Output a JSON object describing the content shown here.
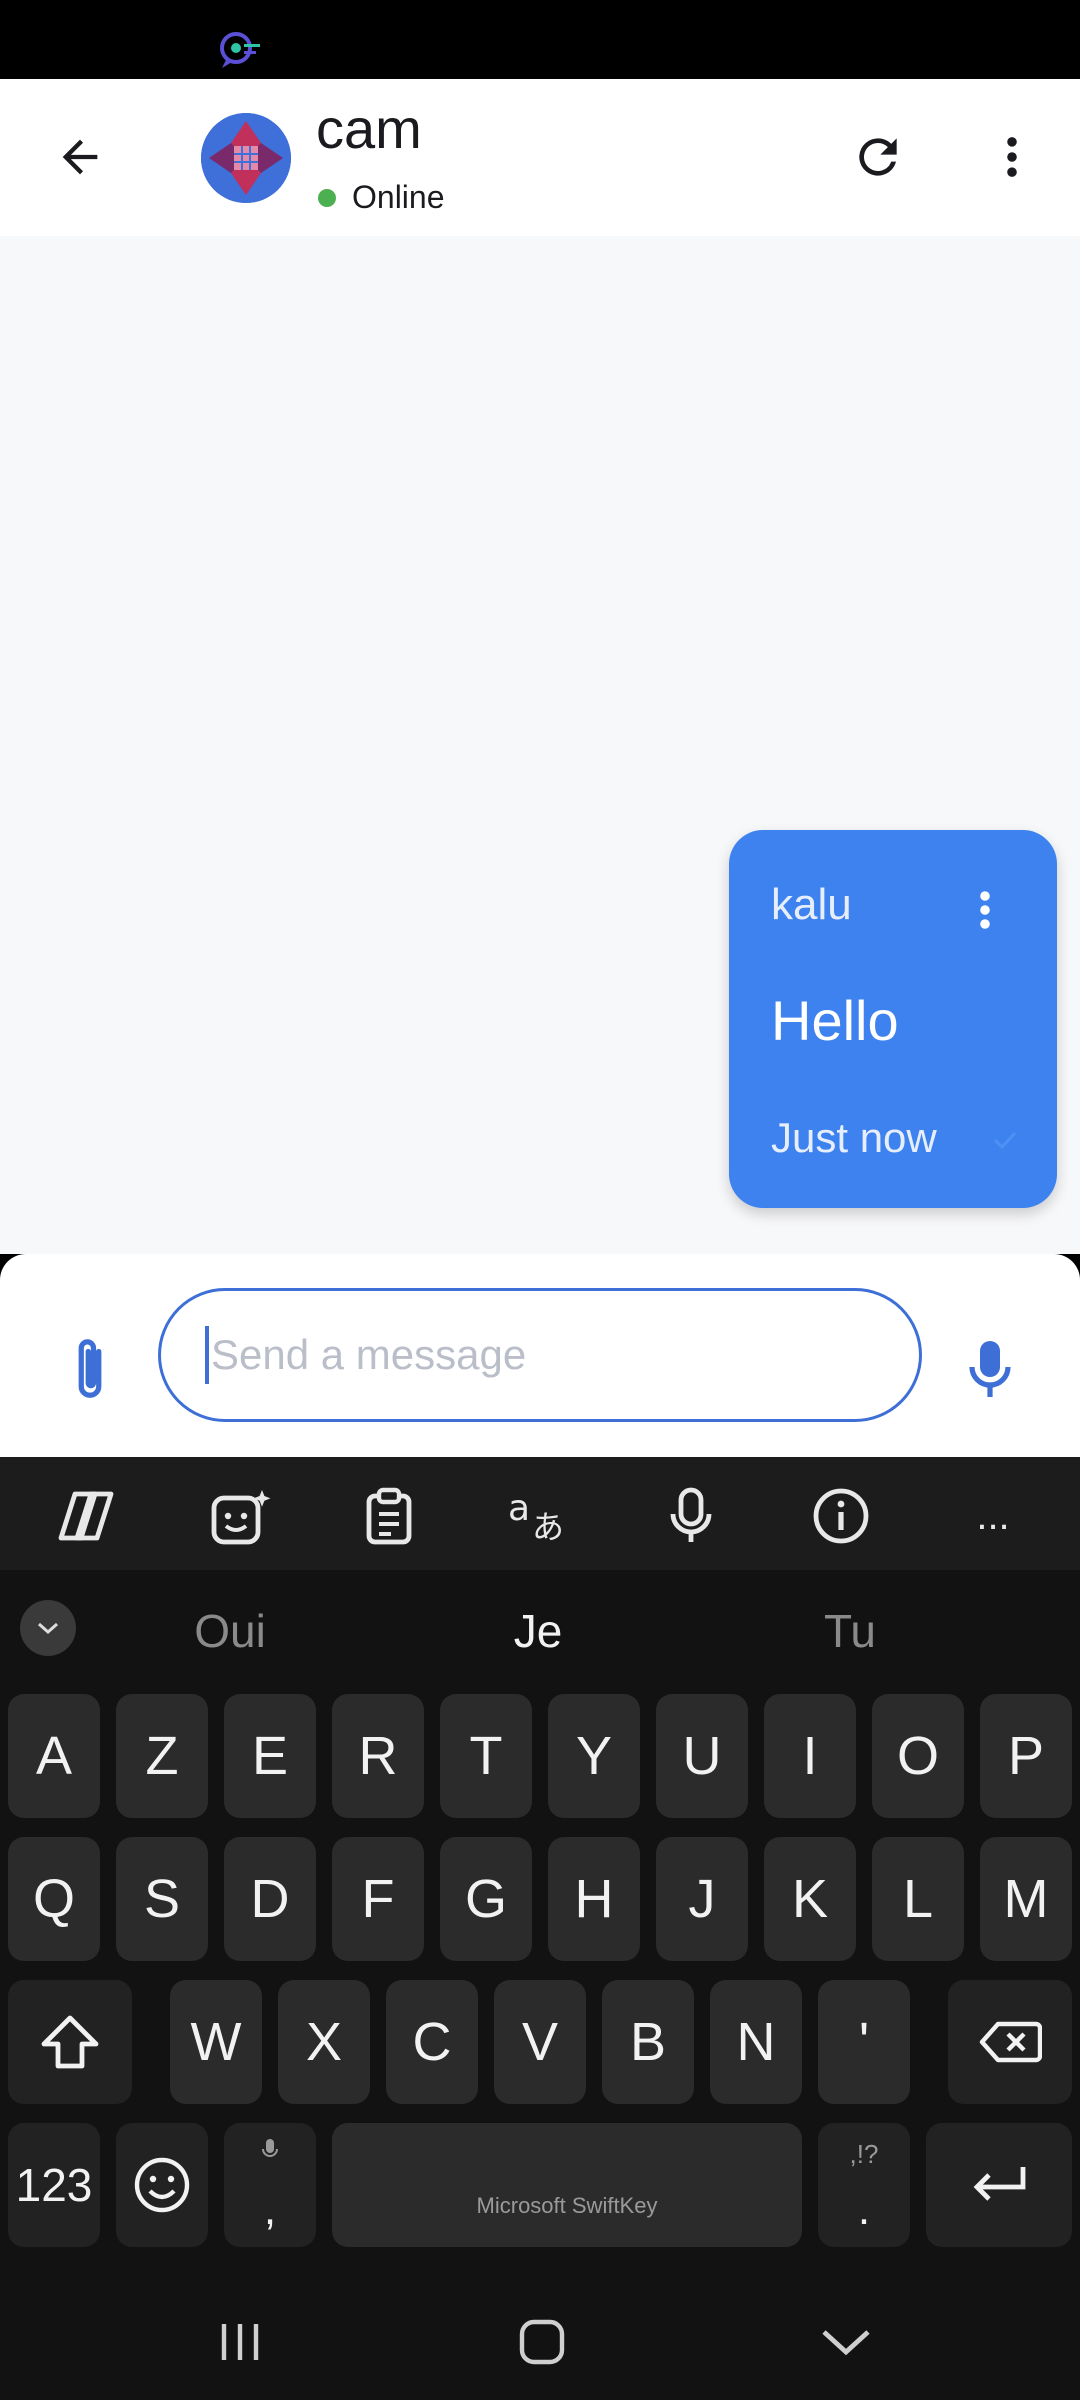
{
  "contact": {
    "name": "cam",
    "status": "Online"
  },
  "message": {
    "sender": "kalu",
    "text": "Hello",
    "time": "Just now"
  },
  "composer": {
    "placeholder": "Send a message"
  },
  "keyboard": {
    "suggestions": [
      "Oui",
      "Je",
      "Tu"
    ],
    "row1": [
      "A",
      "Z",
      "E",
      "R",
      "T",
      "Y",
      "U",
      "I",
      "O",
      "P"
    ],
    "row2": [
      "Q",
      "S",
      "D",
      "F",
      "G",
      "H",
      "J",
      "K",
      "L",
      "M"
    ],
    "row3": [
      "W",
      "X",
      "C",
      "V",
      "B",
      "N",
      "'"
    ],
    "numbers_label": "123",
    "comma_label": ",",
    "period_label": ".",
    "period_sub": ",!?",
    "space_label": "Microsoft SwiftKey",
    "toolbar_more": "..."
  },
  "colors": {
    "accent": "#3d82ee",
    "online": "#4caf50",
    "keyboard_bg": "#121212"
  },
  "icons": [
    "back-arrow-icon",
    "refresh-icon",
    "more-vert-icon",
    "paperclip-icon",
    "mic-icon",
    "copilot-icon",
    "sticker-icon",
    "clipboard-icon",
    "translate-icon",
    "voice-icon",
    "info-icon",
    "shift-icon",
    "backspace-icon",
    "emoji-icon",
    "enter-icon"
  ]
}
